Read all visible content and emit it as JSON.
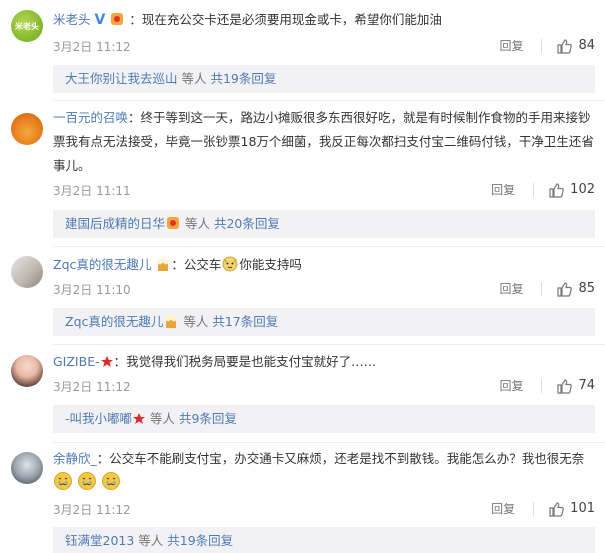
{
  "comments": [
    {
      "username": "米老头",
      "text": "：现在充公交卡还是必须要用现金或卡，希望你们能加油",
      "date": "3月2日 11:12",
      "reply_label": "回复",
      "likes": "84",
      "sub": {
        "user": "大王你别让我去巡山",
        "mid": " 等人 ",
        "count": "共19条回复"
      }
    },
    {
      "username": "一百元的召唤",
      "text_line1": "：终于等到这一天，路边小摊贩很多东西很好吃，就是有时候制作食物的手用来接钞",
      "text_line2": "票我有点无法接受，毕竟一张钞票18万个细菌，我反正每次都扫支付宝二维码付钱，干净卫生还省",
      "text_line3": "事儿。",
      "date": "3月2日 11:11",
      "reply_label": "回复",
      "likes": "102",
      "sub": {
        "user": "建国后成精的日华",
        "mid": " 等人 ",
        "count": "共20条回复"
      }
    },
    {
      "username": "Zqc真的很无趣儿",
      "text": "：公交车",
      "text2": "你能支持吗",
      "date": "3月2日 11:10",
      "reply_label": "回复",
      "likes": "85",
      "sub": {
        "user": "Zqc真的很无趣儿",
        "mid": " 等人 ",
        "count": "共17条回复"
      }
    },
    {
      "username": "GIZIBE-",
      "text": "：我觉得我们税务局要是也能支付宝就好了……",
      "date": "3月2日 11:12",
      "reply_label": "回复",
      "likes": "74",
      "sub": {
        "user": "-叫我小嘟嘟",
        "mid": " 等人 ",
        "count": "共9条回复"
      }
    },
    {
      "username": "余静欣_",
      "text": "：公交车不能刷支付宝，办交通卡又麻烦，还老是找不到散钱。我能怎么办？我也很无奈",
      "date": "3月2日 11:12",
      "reply_label": "回复",
      "likes": "101",
      "sub": {
        "user": "钰满堂2013",
        "mid": " 等人 ",
        "count": "共19条回复"
      }
    }
  ],
  "avatar1_text": "米老头",
  "colors": {
    "link": "#4f7ab3",
    "meta": "#999999",
    "subbox": "#f2f2f5"
  },
  "icons": [
    "verified-v-icon",
    "thumbs-up-icon",
    "red-star-icon",
    "crying-emoji-icon",
    "cat-emoji-icon",
    "popcorn-emoji-icon"
  ]
}
